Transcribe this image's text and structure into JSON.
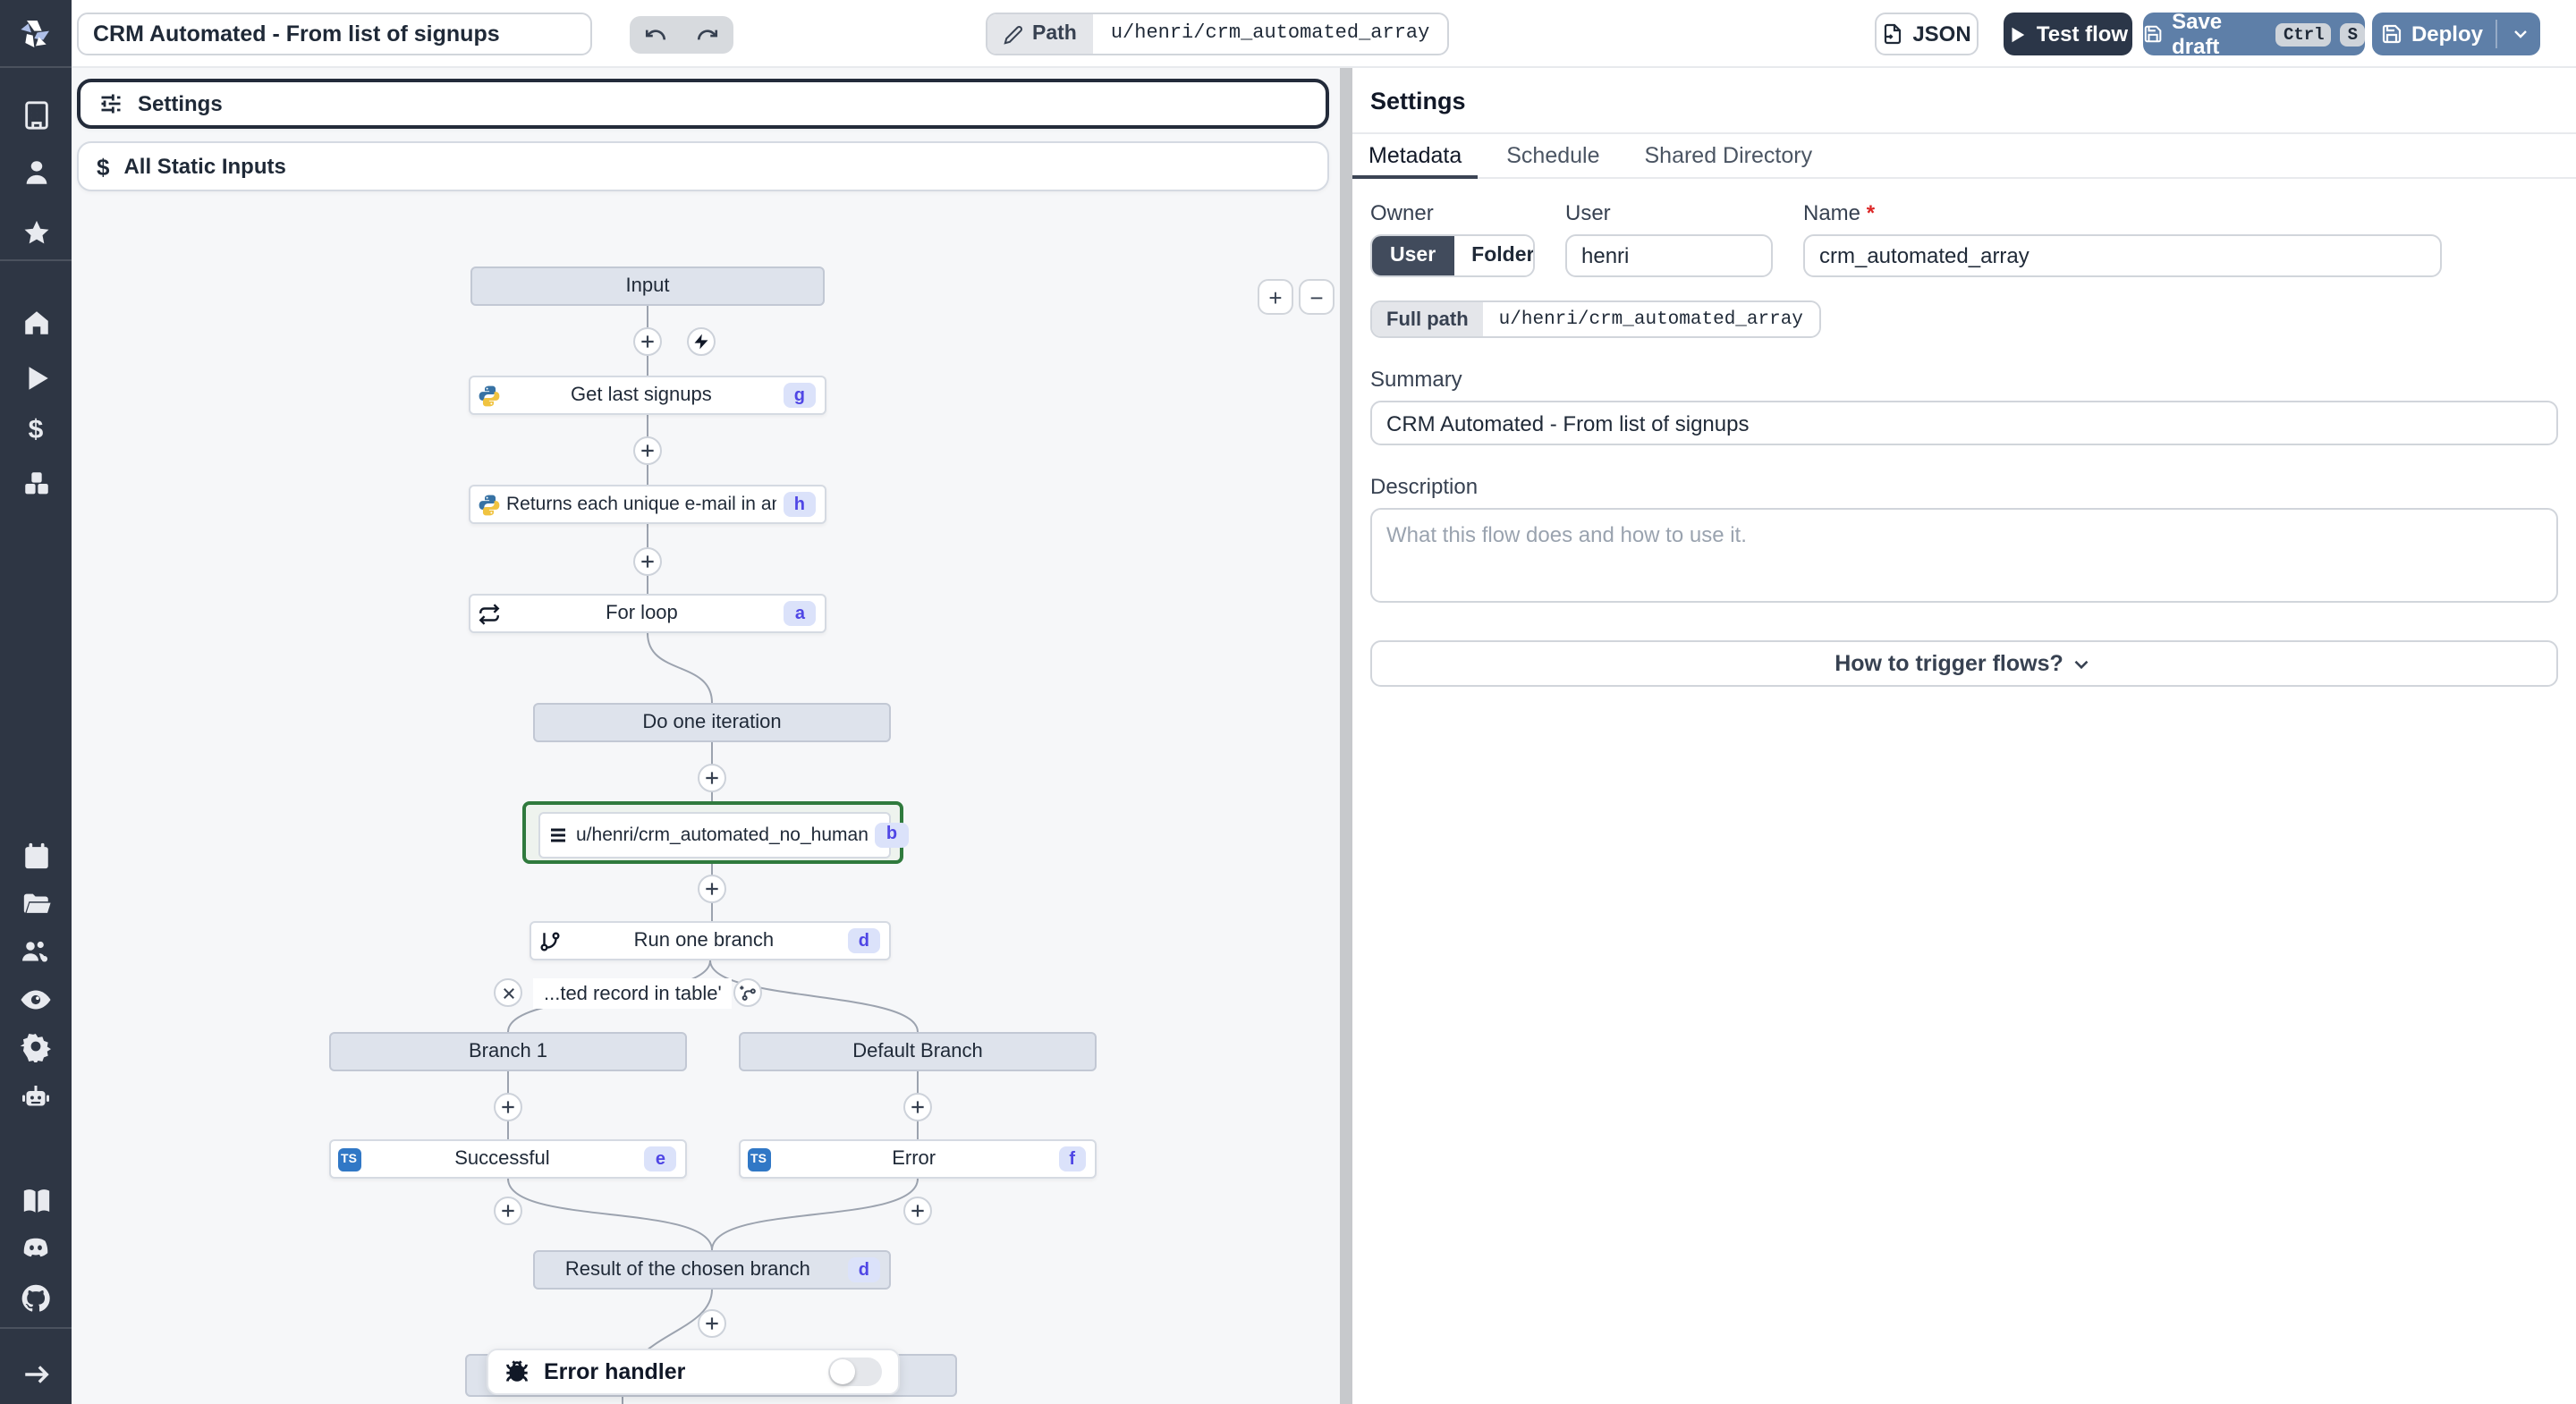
{
  "topbar": {
    "title": "CRM Automated - From list of signups",
    "path_label": "Path",
    "path_value": "u/henri/crm_automated_array",
    "json_label": "JSON",
    "test_flow_label": "Test flow",
    "save_draft_label": "Save draft",
    "kbd_ctrl": "Ctrl",
    "kbd_s": "S",
    "deploy_label": "Deploy"
  },
  "sidebar": {
    "icons": [
      "windmill-logo",
      "workspace",
      "user",
      "favorites",
      "home",
      "runs",
      "variables",
      "resources",
      "schedules",
      "folders",
      "groups",
      "audit-logs",
      "settings",
      "ai",
      "docs",
      "discord",
      "github",
      "collapse"
    ]
  },
  "canvas": {
    "settings_label": "Settings",
    "static_inputs_label": "All Static Inputs",
    "zoom_in": "+",
    "zoom_out": "−",
    "ts": "TS",
    "nodes": {
      "input": {
        "label": "Input"
      },
      "get_last": {
        "label": "Get last signups",
        "badge": "g"
      },
      "returns": {
        "label": "Returns each unique e-mail in an array",
        "badge": "h"
      },
      "forloop": {
        "label": "For loop",
        "badge": "a"
      },
      "do_one": {
        "label": "Do one iteration"
      },
      "selected": {
        "label": "u/henri/crm_automated_no_human",
        "badge": "b"
      },
      "run_one": {
        "label": "Run one branch",
        "badge": "d"
      },
      "condition": {
        "label": "...ted record in table'"
      },
      "branch1": {
        "label": "Branch 1"
      },
      "default_branch": {
        "label": "Default Branch"
      },
      "successful": {
        "label": "Successful",
        "badge": "e"
      },
      "error": {
        "label": "Error",
        "badge": "f"
      },
      "result": {
        "label": "Result of the chosen branch",
        "badge": "d"
      },
      "error_handler": {
        "label": "Error handler"
      }
    },
    "colors": {
      "selected_border": "#2f7a3d",
      "badge_bg": "#dbe2fa",
      "badge_text": "#4f46e5",
      "node_gray": "#dee3ec",
      "edge": "#9ca3af"
    }
  },
  "panel": {
    "heading": "Settings",
    "tabs": [
      {
        "label": "Metadata"
      },
      {
        "label": "Schedule"
      },
      {
        "label": "Shared Directory"
      }
    ],
    "owner_label": "Owner",
    "owner_user": "User",
    "owner_folder": "Folder",
    "user_label": "User",
    "user_value": "henri",
    "name_label": "Name",
    "required_mark": "*",
    "name_value": "crm_automated_array",
    "full_path_label": "Full path",
    "full_path_value": "u/henri/crm_automated_array",
    "summary_label": "Summary",
    "summary_value": "CRM Automated - From list of signups",
    "description_label": "Description",
    "description_placeholder": "What this flow does and how to use it.",
    "trigger_button": "How to trigger flows?"
  }
}
